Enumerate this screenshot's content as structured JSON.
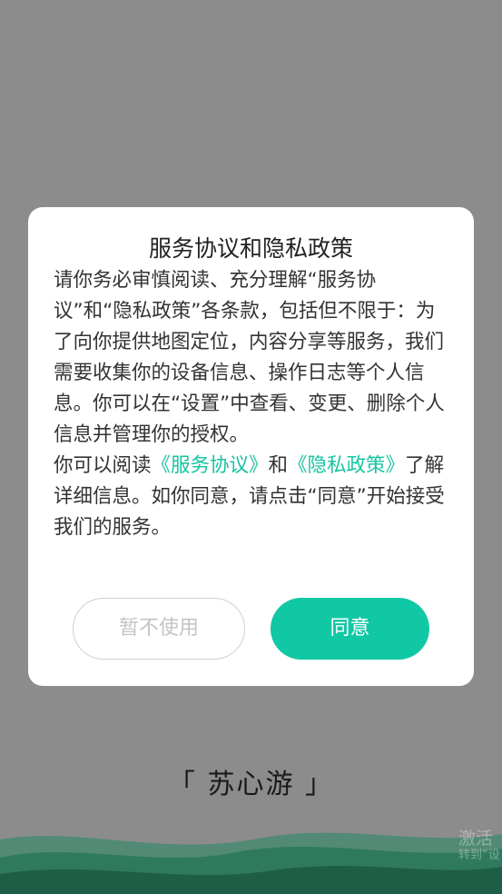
{
  "dialog": {
    "title": "服务协议和隐私政策",
    "paragraph1": "请你务必审慎阅读、充分理解“服务协议”和“隐私政策”各条款，包括但不限于：为了向你提供地图定位，内容分享等服务，我们需要收集你的设备信息、操作日志等个人信息。你可以在“设置”中查看、变更、删除个人信息并管理你的授权。",
    "paragraph2_prefix": "你可以阅读",
    "service_link": "《服务协议》",
    "paragraph2_and": "和",
    "privacy_link": "《隐私政策》",
    "paragraph2_suffix": "了解详细信息。如你同意，请点击“同意”开始接受我们的服务。",
    "decline_label": "暂不使用",
    "agree_label": "同意"
  },
  "brand": {
    "name": "「 苏心游 」"
  },
  "watermark": {
    "line1": "激活",
    "line2": "转到“设"
  },
  "colors": {
    "accent": "#11c8a4",
    "link": "#17c3a0",
    "overlay": "#8c8c8c",
    "hills": "#2a6b52"
  }
}
